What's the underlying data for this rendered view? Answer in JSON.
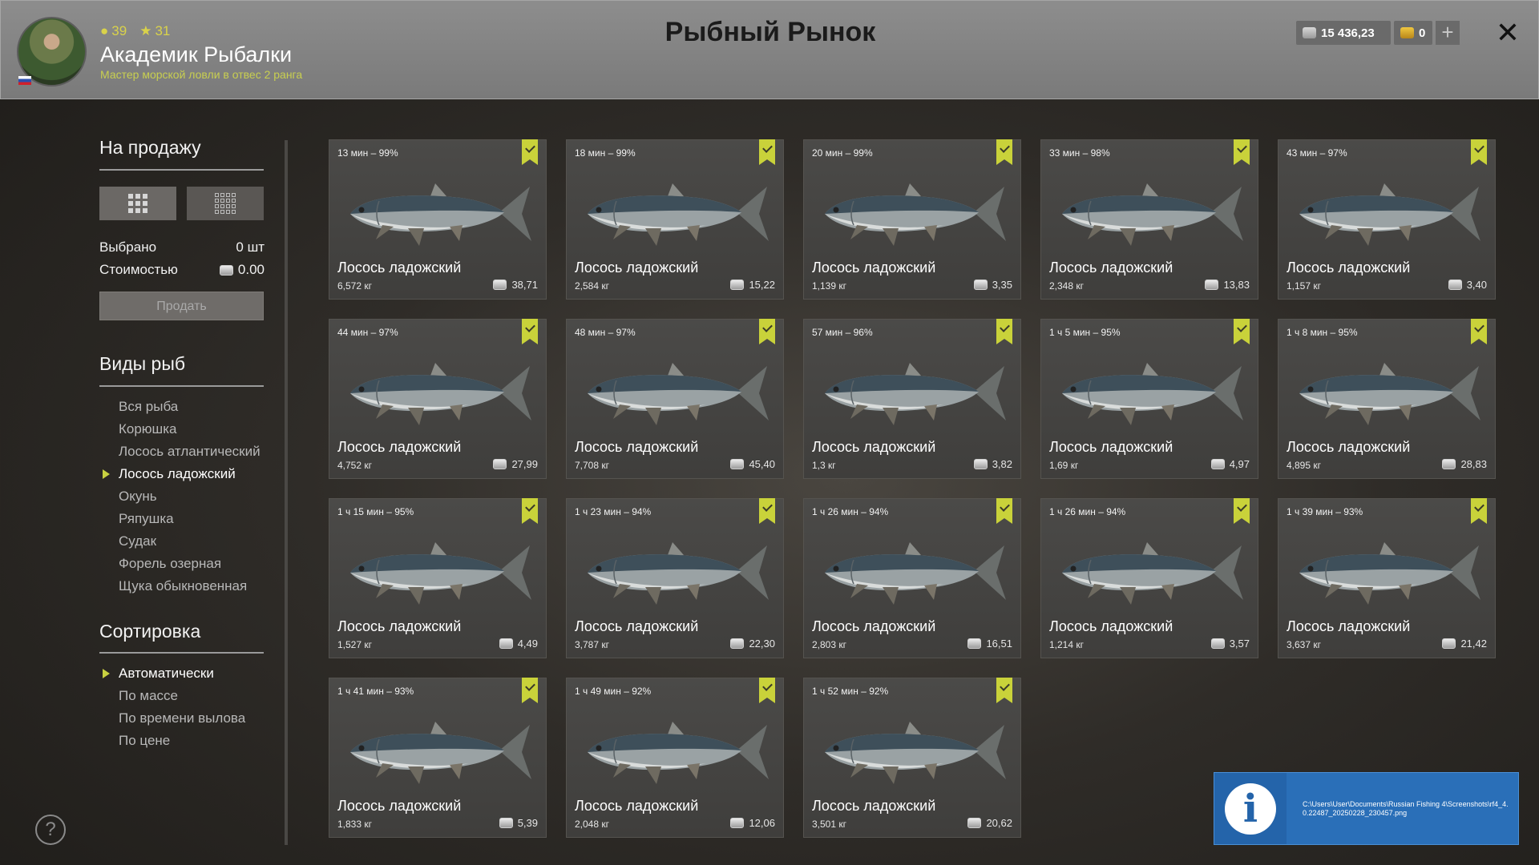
{
  "header": {
    "title": "Рыбный Рынок",
    "level": "39",
    "stars": "31",
    "player_name": "Академик Рыбалки",
    "player_rank": "Мастер морской ловли в отвес 2 ранга",
    "silver": "15 436,23",
    "gold": "0",
    "plus_label": "+",
    "close_label": "✕"
  },
  "sidebar": {
    "sale_title": "На продажу",
    "selected_label": "Выбрано",
    "selected_value": "0 шт",
    "cost_label": "Стоимостью",
    "cost_value": "0.00",
    "sell_button": "Продать",
    "species_title": "Виды рыб",
    "species": [
      {
        "label": "Вся рыба",
        "active": false
      },
      {
        "label": "Корюшка",
        "active": false
      },
      {
        "label": "Лосось атлантический",
        "active": false
      },
      {
        "label": "Лосось ладожский",
        "active": true
      },
      {
        "label": "Окунь",
        "active": false
      },
      {
        "label": "Ряпушка",
        "active": false
      },
      {
        "label": "Судак",
        "active": false
      },
      {
        "label": "Форель озерная",
        "active": false
      },
      {
        "label": "Щука обыкновенная",
        "active": false
      }
    ],
    "sort_title": "Сортировка",
    "sort": [
      {
        "label": "Автоматически",
        "active": true
      },
      {
        "label": "По массе",
        "active": false
      },
      {
        "label": "По времени вылова",
        "active": false
      },
      {
        "label": "По цене",
        "active": false
      }
    ],
    "help_label": "?"
  },
  "fish": [
    {
      "time": "13 мин – 99%",
      "name": "Лосось ладожский",
      "weight": "6,572 кг",
      "price": "38,71"
    },
    {
      "time": "18 мин – 99%",
      "name": "Лосось ладожский",
      "weight": "2,584 кг",
      "price": "15,22"
    },
    {
      "time": "20 мин – 99%",
      "name": "Лосось ладожский",
      "weight": "1,139 кг",
      "price": "3,35"
    },
    {
      "time": "33 мин – 98%",
      "name": "Лосось ладожский",
      "weight": "2,348 кг",
      "price": "13,83"
    },
    {
      "time": "43 мин – 97%",
      "name": "Лосось ладожский",
      "weight": "1,157 кг",
      "price": "3,40"
    },
    {
      "time": "44 мин – 97%",
      "name": "Лосось ладожский",
      "weight": "4,752 кг",
      "price": "27,99"
    },
    {
      "time": "48 мин – 97%",
      "name": "Лосось ладожский",
      "weight": "7,708 кг",
      "price": "45,40"
    },
    {
      "time": "57 мин – 96%",
      "name": "Лосось ладожский",
      "weight": "1,3 кг",
      "price": "3,82"
    },
    {
      "time": "1 ч 5 мин – 95%",
      "name": "Лосось ладожский",
      "weight": "1,69 кг",
      "price": "4,97"
    },
    {
      "time": "1 ч 8 мин – 95%",
      "name": "Лосось ладожский",
      "weight": "4,895 кг",
      "price": "28,83"
    },
    {
      "time": "1 ч 15 мин – 95%",
      "name": "Лосось ладожский",
      "weight": "1,527 кг",
      "price": "4,49"
    },
    {
      "time": "1 ч 23 мин – 94%",
      "name": "Лосось ладожский",
      "weight": "3,787 кг",
      "price": "22,30"
    },
    {
      "time": "1 ч 26 мин – 94%",
      "name": "Лосось ладожский",
      "weight": "2,803 кг",
      "price": "16,51"
    },
    {
      "time": "1 ч 26 мин – 94%",
      "name": "Лосось ладожский",
      "weight": "1,214 кг",
      "price": "3,57"
    },
    {
      "time": "1 ч 39 мин – 93%",
      "name": "Лосось ладожский",
      "weight": "3,637 кг",
      "price": "21,42"
    },
    {
      "time": "1 ч 41 мин – 93%",
      "name": "Лосось ладожский",
      "weight": "1,833 кг",
      "price": "5,39"
    },
    {
      "time": "1 ч 49 мин – 92%",
      "name": "Лосось ладожский",
      "weight": "2,048 кг",
      "price": "12,06"
    },
    {
      "time": "1 ч 52 мин – 92%",
      "name": "Лосось ладожский",
      "weight": "3,501 кг",
      "price": "20,62"
    }
  ],
  "notification": {
    "icon_label": "i",
    "text": "C:\\Users\\User\\Documents\\Russian Fishing 4\\Screenshots\\rf4_4.0.22487_20250228_230457.png"
  },
  "colors": {
    "accent": "#c9d23a",
    "notify_bg": "#2a6fb8"
  }
}
